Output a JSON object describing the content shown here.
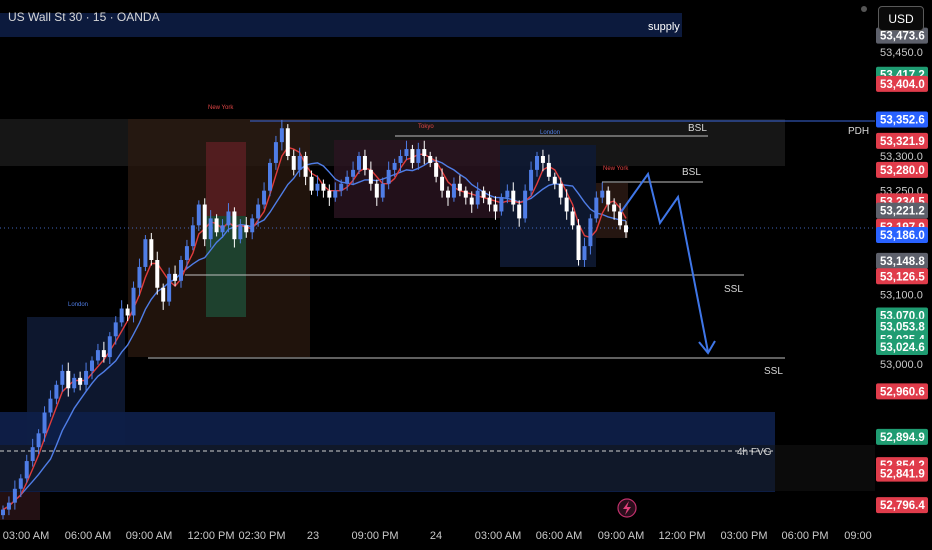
{
  "header": {
    "title": "US Wall St 30 · 15 · OANDA"
  },
  "toolbar": {
    "currency": "USD"
  },
  "colors": {
    "background": "#000000",
    "bull_candle": "#4f7de6",
    "bear_candle": "#ffffff",
    "ma_fast": "#e03c3c",
    "ma_slow": "#4f7de6",
    "green_badge": "#1f9c72",
    "red_badge": "#e03c4b",
    "gray_badge": "#5d606b",
    "blue_badge": "#2962ff",
    "arrow": "#3f76e8"
  },
  "chart_data": {
    "type": "candlestick",
    "symbol": "US Wall St 30",
    "timeframe": "15",
    "source": "OANDA",
    "ylim": [
      52760,
      53500
    ],
    "time_axis": [
      "03:00 AM",
      "06:00 AM",
      "09:00 AM",
      "12:00 PM",
      "02:30 PM",
      "23",
      "09:00 PM",
      "24",
      "03:00 AM",
      "06:00 AM",
      "09:00 AM",
      "12:00 PM",
      "03:00 PM",
      "06:00 PM",
      "09:00"
    ],
    "y_ticks": [
      "53,450.0",
      "53,300.0",
      "53,250.0",
      "53,100.0",
      "53,000.0"
    ],
    "price_badges": [
      {
        "label": "53,473.6",
        "price": 53473.6,
        "color": "gray"
      },
      {
        "label": "53,417.2",
        "price": 53417.2,
        "color": "green"
      },
      {
        "label": "53,404.0",
        "price": 53404.0,
        "color": "red"
      },
      {
        "label": "53,352.6",
        "price": 53352.6,
        "color": "blue"
      },
      {
        "label": "53,321.9",
        "price": 53321.9,
        "color": "red"
      },
      {
        "label": "53,280.0",
        "price": 53280.0,
        "color": "red"
      },
      {
        "label": "53,234.5",
        "price": 53234.5,
        "color": "red"
      },
      {
        "label": "53,221.2",
        "price": 53221.2,
        "color": "gray"
      },
      {
        "label": "53,197.9",
        "price": 53197.9,
        "color": "red"
      },
      {
        "label": "53,186.0",
        "price": 53186.0,
        "color": "blue"
      },
      {
        "label": "53,148.8",
        "price": 53148.8,
        "color": "gray"
      },
      {
        "label": "53,126.5",
        "price": 53126.5,
        "color": "red"
      },
      {
        "label": "53,070.0",
        "price": 53070.0,
        "color": "green"
      },
      {
        "label": "53,053.8",
        "price": 53053.8,
        "color": "green"
      },
      {
        "label": "53,035.4",
        "price": 53035.4,
        "color": "green"
      },
      {
        "label": "53,024.6",
        "price": 53024.6,
        "color": "green"
      },
      {
        "label": "52,960.6",
        "price": 52960.6,
        "color": "red"
      },
      {
        "label": "52,894.9",
        "price": 52894.9,
        "color": "green"
      },
      {
        "label": "52,854.2",
        "price": 52854.2,
        "color": "red"
      },
      {
        "label": "52,841.9",
        "price": 52841.9,
        "color": "red"
      },
      {
        "label": "52,796.4",
        "price": 52796.4,
        "color": "red"
      }
    ],
    "levels": [
      {
        "label": "PDH",
        "price": 53352.6
      },
      {
        "label": "BSL",
        "price": 53342
      },
      {
        "label": "BSL",
        "price": 53268
      },
      {
        "label": "SSL",
        "price": 53129
      },
      {
        "label": "SSL",
        "price": 53005
      },
      {
        "label": "4h FVG",
        "price": 52883
      }
    ],
    "zones": [
      {
        "label": "supply",
        "price_low": 53470,
        "price_high": 53505
      }
    ],
    "session_labels": [
      "New York",
      "Tokyo",
      "London",
      "New York",
      "London"
    ],
    "close_series": [
      52790,
      52800,
      52820,
      52835,
      52860,
      52880,
      52900,
      52930,
      52950,
      52970,
      52990,
      52965,
      52980,
      52970,
      52990,
      53005,
      53020,
      53010,
      53040,
      53060,
      53080,
      53070,
      53110,
      53140,
      53180,
      53150,
      53110,
      53090,
      53130,
      53120,
      53150,
      53170,
      53200,
      53230,
      53180,
      53210,
      53190,
      53200,
      53220,
      53180,
      53200,
      53190,
      53210,
      53230,
      53250,
      53290,
      53320,
      53340,
      53300,
      53280,
      53300,
      53270,
      53250,
      53260,
      53250,
      53240,
      53250,
      53260,
      53270,
      53280,
      53300,
      53280,
      53260,
      53240,
      53260,
      53280,
      53290,
      53300,
      53310,
      53290,
      53310,
      53300,
      53290,
      53270,
      53250,
      53240,
      53260,
      53250,
      53240,
      53230,
      53250,
      53240,
      53230,
      53220,
      53240,
      53250,
      53230,
      53210,
      53250,
      53280,
      53300,
      53290,
      53270,
      53260,
      53240,
      53220,
      53200,
      53150,
      53170,
      53210,
      53240,
      53250,
      53230,
      53220,
      53200,
      53190
    ]
  }
}
